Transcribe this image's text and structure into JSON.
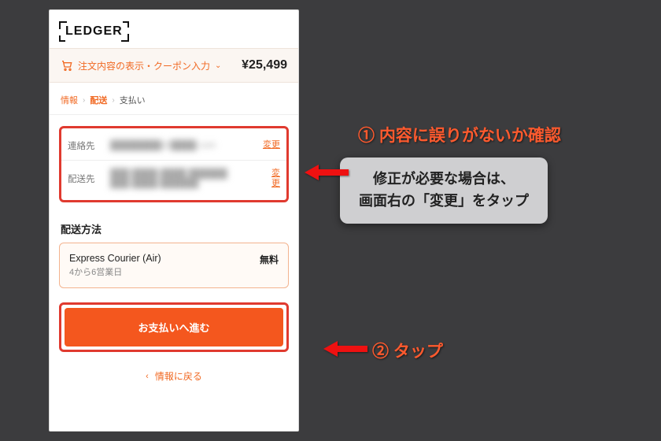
{
  "logo": "LEDGER",
  "summary": {
    "label": "注文内容の表示・クーポン入力",
    "price": "¥25,499"
  },
  "breadcrumbs": {
    "info": "情報",
    "shipping": "配送",
    "pay": "支払い"
  },
  "review": {
    "contact": {
      "label": "連絡先",
      "masked": "████████@████.com",
      "change": "変更"
    },
    "ship": {
      "label": "配送先",
      "masked": "███ ████-████ ██████\n███ ████ ██████",
      "change": "変更"
    }
  },
  "shipping": {
    "title": "配送方法",
    "method": "Express Courier (Air)",
    "eta": "4から6営業日",
    "price": "無料"
  },
  "cta": "お支払いへ進む",
  "back": "情報に戻る",
  "annot": {
    "step1": "① 内容に誤りがないか確認",
    "note_l1": "修正が必要な場合は、",
    "note_l2": "画面右の「変更」をタップ",
    "step2": "② タップ"
  }
}
